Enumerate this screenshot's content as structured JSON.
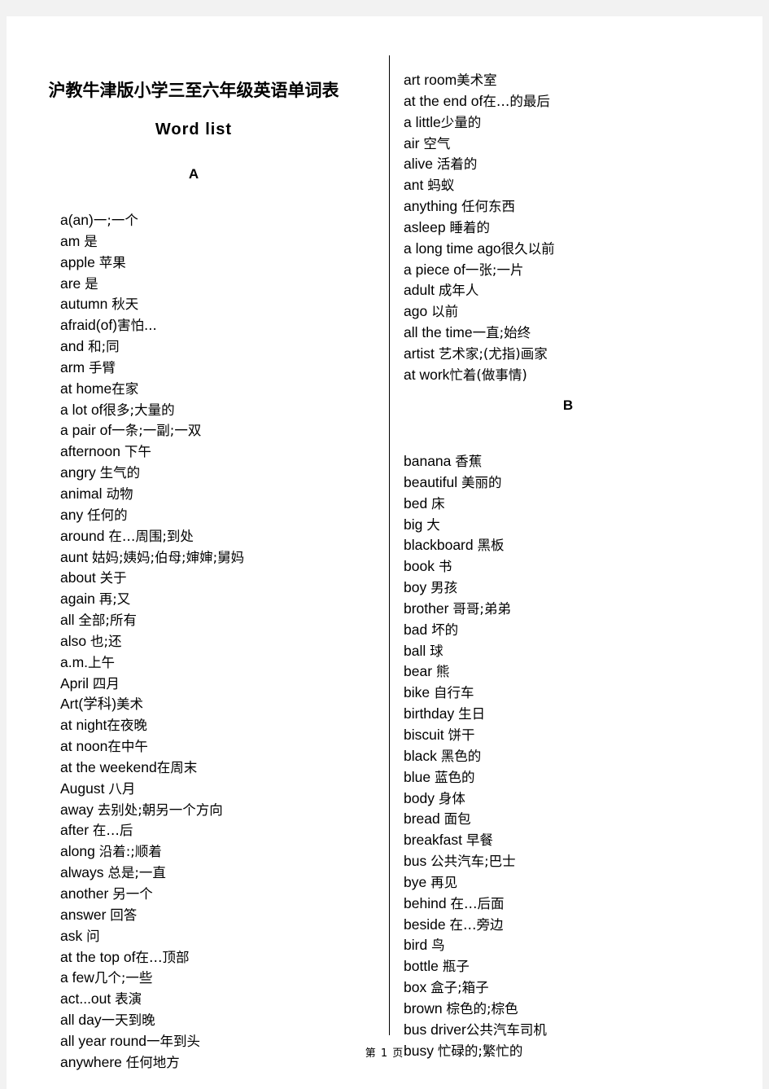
{
  "document": {
    "title": "沪教牛津版小学三至六年级英语单词表",
    "subtitle": "Word  list",
    "footer": "第 1 页"
  },
  "sections": [
    {
      "letter": "A",
      "column": "left",
      "entries": [
        {
          "en": "a(an)",
          "cn": "一;一个",
          "space": false
        },
        {
          "en": "am",
          "cn": "是",
          "space": true
        },
        {
          "en": "apple",
          "cn": "苹果",
          "space": true
        },
        {
          "en": "are",
          "cn": "是",
          "space": true
        },
        {
          "en": "autumn",
          "cn": "秋天",
          "space": true
        },
        {
          "en": "afraid(of)",
          "cn": "害怕...",
          "space": false
        },
        {
          "en": "and",
          "cn": "和;同",
          "space": true
        },
        {
          "en": "arm",
          "cn": "手臂",
          "space": true
        },
        {
          "en": "at  home",
          "cn": "在家",
          "space": false
        },
        {
          "en": "a  lot  of",
          "cn": "很多;大量的",
          "space": false
        },
        {
          "en": "a  pair  of",
          "cn": "一条;一副;一双",
          "space": false
        },
        {
          "en": "afternoon",
          "cn": "下午",
          "space": true
        },
        {
          "en": "angry",
          "cn": "生气的",
          "space": true
        },
        {
          "en": "animal",
          "cn": "动物",
          "space": true
        },
        {
          "en": "any",
          "cn": "任何的",
          "space": true
        },
        {
          "en": "around",
          "cn": "在…周围;到处",
          "space": true
        },
        {
          "en": "aunt",
          "cn": "姑妈;姨妈;伯母;婶婶;舅妈",
          "space": true
        },
        {
          "en": "about",
          "cn": "关于",
          "space": true
        },
        {
          "en": "again",
          "cn": "再;又",
          "space": true
        },
        {
          "en": "all",
          "cn": "全部;所有",
          "space": true
        },
        {
          "en": "also",
          "cn": "也;还",
          "space": true
        },
        {
          "en": "a.m.",
          "cn": "上午",
          "space": false
        },
        {
          "en": "April",
          "cn": "四月",
          "space": true
        },
        {
          "en": "Art(学科)",
          "cn": "美术",
          "space": false
        },
        {
          "en": "at  night",
          "cn": "在夜晚",
          "space": false
        },
        {
          "en": "at  noon",
          "cn": "在中午",
          "space": false
        },
        {
          "en": "at  the  weekend",
          "cn": "在周末",
          "space": false
        },
        {
          "en": "August",
          "cn": "八月",
          "space": true
        },
        {
          "en": "away",
          "cn": "去别处;朝另一个方向",
          "space": true
        },
        {
          "en": "after",
          "cn": "在…后",
          "space": true
        },
        {
          "en": "along",
          "cn": "沿着:;顺着",
          "space": true
        },
        {
          "en": "always",
          "cn": "总是;一直",
          "space": true
        },
        {
          "en": "another",
          "cn": "另一个",
          "space": true
        },
        {
          "en": "answer",
          "cn": "回答",
          "space": true
        },
        {
          "en": "ask",
          "cn": "问",
          "space": true
        },
        {
          "en": "at  the  top  of",
          "cn": "在…顶部",
          "space": false
        },
        {
          "en": "a  few",
          "cn": "几个;一些",
          "space": false
        },
        {
          "en": "act...out",
          "cn": "表演",
          "space": true
        },
        {
          "en": "all  day",
          "cn": "一天到晚",
          "space": false
        },
        {
          "en": "all  year  round",
          "cn": "一年到头",
          "space": false
        },
        {
          "en": "anywhere",
          "cn": "任何地方",
          "space": true
        }
      ]
    },
    {
      "letter": "A",
      "column": "right-continued",
      "entries": [
        {
          "en": "art  room",
          "cn": "美术室",
          "space": false
        },
        {
          "en": "at  the  end  of",
          "cn": "在…的最后",
          "space": false
        },
        {
          "en": "a  little",
          "cn": "少量的",
          "space": false
        },
        {
          "en": "air",
          "cn": "空气",
          "space": true
        },
        {
          "en": "alive",
          "cn": "活着的",
          "space": true
        },
        {
          "en": "ant",
          "cn": "蚂蚁",
          "space": true
        },
        {
          "en": "anything",
          "cn": "任何东西",
          "space": true
        },
        {
          "en": "asleep",
          "cn": "睡着的",
          "space": true
        },
        {
          "en": "a  long  time  ago",
          "cn": "很久以前",
          "space": false
        },
        {
          "en": "a  piece  of",
          "cn": "一张;一片",
          "space": false
        },
        {
          "en": "adult",
          "cn": "成年人",
          "space": true
        },
        {
          "en": "ago",
          "cn": "以前",
          "space": true
        },
        {
          "en": "all  the  time",
          "cn": "一直;始终",
          "space": false
        },
        {
          "en": "artist",
          "cn": "艺术家;(尤指)画家",
          "space": true
        },
        {
          "en": "at  work",
          "cn": "忙着(做事情)",
          "space": false
        }
      ]
    },
    {
      "letter": "B",
      "column": "right",
      "entries": [
        {
          "en": "banana",
          "cn": "香蕉",
          "space": true
        },
        {
          "en": "beautiful",
          "cn": "美丽的",
          "space": true
        },
        {
          "en": "bed",
          "cn": "床",
          "space": true
        },
        {
          "en": "big",
          "cn": "大",
          "space": true
        },
        {
          "en": "blackboard",
          "cn": "黑板",
          "space": true
        },
        {
          "en": "book",
          "cn": "书",
          "space": true
        },
        {
          "en": "boy",
          "cn": "男孩",
          "space": true
        },
        {
          "en": "brother",
          "cn": "哥哥;弟弟",
          "space": true
        },
        {
          "en": "bad",
          "cn": "坏的",
          "space": true
        },
        {
          "en": "ball",
          "cn": "球",
          "space": true
        },
        {
          "en": "bear",
          "cn": "熊",
          "space": true
        },
        {
          "en": "bike",
          "cn": "自行车",
          "space": true
        },
        {
          "en": "birthday",
          "cn": "生日",
          "space": true
        },
        {
          "en": "biscuit",
          "cn": "饼干",
          "space": true
        },
        {
          "en": "black",
          "cn": "黑色的",
          "space": true
        },
        {
          "en": "blue",
          "cn": "蓝色的",
          "space": true
        },
        {
          "en": "body",
          "cn": "身体",
          "space": true
        },
        {
          "en": "bread",
          "cn": "面包",
          "space": true
        },
        {
          "en": "breakfast",
          "cn": "早餐",
          "space": true
        },
        {
          "en": "bus",
          "cn": "公共汽车;巴士",
          "space": true
        },
        {
          "en": "bye",
          "cn": "再见",
          "space": true
        },
        {
          "en": "behind",
          "cn": "在…后面",
          "space": true
        },
        {
          "en": "beside",
          "cn": "在…旁边",
          "space": true
        },
        {
          "en": "bird",
          "cn": "鸟",
          "space": true
        },
        {
          "en": "bottle",
          "cn": "瓶子",
          "space": true
        },
        {
          "en": "box",
          "cn": "盒子;箱子",
          "space": true
        },
        {
          "en": "brown",
          "cn": "棕色的;棕色",
          "space": true
        },
        {
          "en": "bus  driver",
          "cn": "公共汽车司机",
          "space": false
        },
        {
          "en": "busy",
          "cn": "忙碌的;繁忙的",
          "space": true
        }
      ]
    }
  ]
}
